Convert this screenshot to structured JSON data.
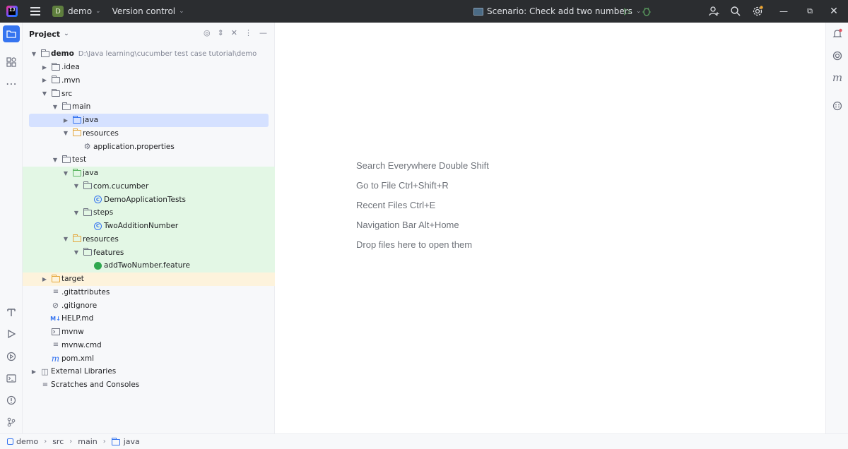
{
  "titlebar": {
    "project_badge": "D",
    "project_name": "demo",
    "vcs_label": "Version control",
    "run_config": "Scenario: Check add two numbers",
    "icons": [
      "menu-icon",
      "run-icon",
      "debug-icon",
      "add-user-icon",
      "search-icon",
      "settings-icon",
      "minimize-icon",
      "restore-icon",
      "close-icon"
    ]
  },
  "project_panel": {
    "title": "Project",
    "tree": [
      {
        "label": "demo",
        "path": "D:\\Java learning\\cucumber test case tutorial\\demo",
        "icon": "module-folder-icon"
      },
      {
        "label": ".idea",
        "icon": "folder-icon"
      },
      {
        "label": ".mvn",
        "icon": "folder-icon"
      },
      {
        "label": "src",
        "icon": "folder-icon"
      },
      {
        "label": "main",
        "icon": "folder-icon"
      },
      {
        "label": "java",
        "icon": "source-folder-icon"
      },
      {
        "label": "resources",
        "icon": "resources-folder-icon"
      },
      {
        "label": "application.properties",
        "icon": "properties-icon"
      },
      {
        "label": "test",
        "icon": "folder-icon"
      },
      {
        "label": "java",
        "icon": "test-folder-icon"
      },
      {
        "label": "com.cucumber",
        "icon": "package-icon"
      },
      {
        "label": "DemoApplicationTests",
        "icon": "class-icon"
      },
      {
        "label": "steps",
        "icon": "package-icon"
      },
      {
        "label": "TwoAdditionNumber",
        "icon": "class-icon"
      },
      {
        "label": "resources",
        "icon": "test-resources-icon"
      },
      {
        "label": "features",
        "icon": "folder-icon"
      },
      {
        "label": "addTwoNumber.feature",
        "icon": "cucumber-icon"
      },
      {
        "label": "target",
        "icon": "excluded-folder-icon"
      },
      {
        "label": ".gitattributes",
        "icon": "text-file-icon"
      },
      {
        "label": ".gitignore",
        "icon": "ignore-file-icon"
      },
      {
        "label": "HELP.md",
        "icon": "markdown-icon"
      },
      {
        "label": "mvnw",
        "icon": "shell-script-icon"
      },
      {
        "label": "mvnw.cmd",
        "icon": "text-file-icon"
      },
      {
        "label": "pom.xml",
        "icon": "maven-icon"
      },
      {
        "label": "External Libraries",
        "icon": "libraries-icon"
      },
      {
        "label": "Scratches and Consoles",
        "icon": "scratches-icon"
      }
    ]
  },
  "editor": {
    "hints": [
      "Search Everywhere Double Shift",
      "Go to File Ctrl+Shift+R",
      "Recent Files Ctrl+E",
      "Navigation Bar Alt+Home",
      "Drop files here to open them"
    ]
  },
  "statusbar": {
    "breadcrumbs": [
      "demo",
      "src",
      "main",
      "java"
    ]
  },
  "colors": {
    "titlebar_bg": "#2b2d30",
    "accent": "#3574f0",
    "selection": "#d5e1ff",
    "test_highlight": "#e3f7e5",
    "excluded_highlight": "#fdf3dc"
  }
}
